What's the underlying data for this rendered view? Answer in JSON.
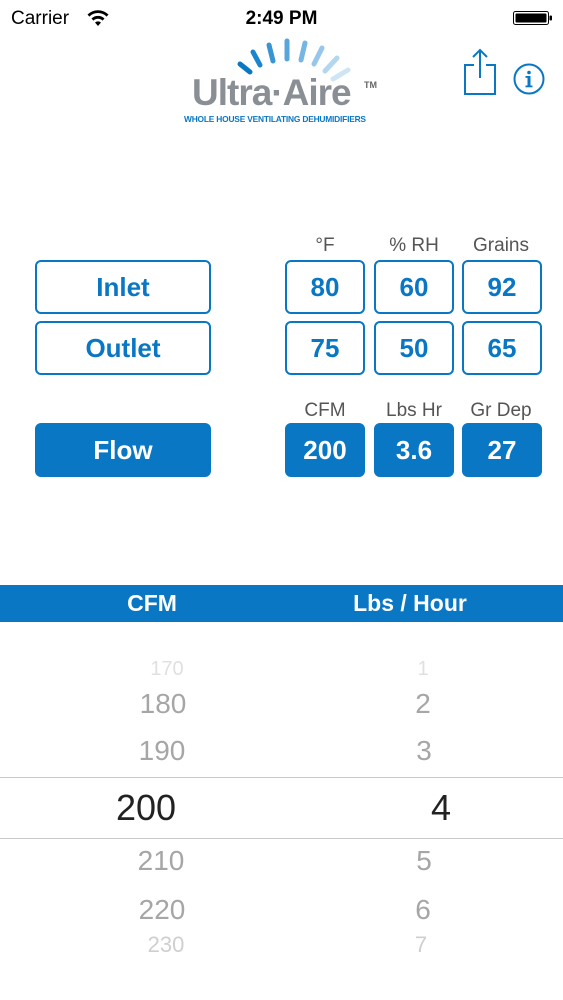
{
  "status_bar": {
    "carrier": "Carrier",
    "time": "2:49 PM"
  },
  "logo": {
    "word": "Ultra·Aire",
    "tm": "TM",
    "tagline": "WHOLE HOUSE VENTILATING DEHUMIDIFIERS"
  },
  "header": {
    "share_icon": "share-icon",
    "info_icon": "info-icon"
  },
  "columns": {
    "temp": "°F",
    "rh": "% RH",
    "grains": "Grains",
    "cfm": "CFM",
    "lbs_hr": "Lbs Hr",
    "gr_dep": "Gr Dep"
  },
  "buttons": {
    "inlet": "Inlet",
    "outlet": "Outlet",
    "flow": "Flow"
  },
  "inlet": {
    "temp": "80",
    "rh": "60",
    "grains": "92"
  },
  "outlet": {
    "temp": "75",
    "rh": "50",
    "grains": "65"
  },
  "flow": {
    "cfm": "200",
    "lbs_hr": "3.6",
    "gr_dep": "27"
  },
  "picker": {
    "headers": {
      "left": "CFM",
      "right": "Lbs / Hour"
    },
    "left_values": [
      "170",
      "180",
      "190",
      "200",
      "210",
      "220",
      "230"
    ],
    "right_values": [
      "1",
      "2",
      "3",
      "4",
      "5",
      "6",
      "7"
    ],
    "selected_left": "200",
    "selected_right": "4"
  },
  "colors": {
    "accent": "#0a77c4"
  }
}
